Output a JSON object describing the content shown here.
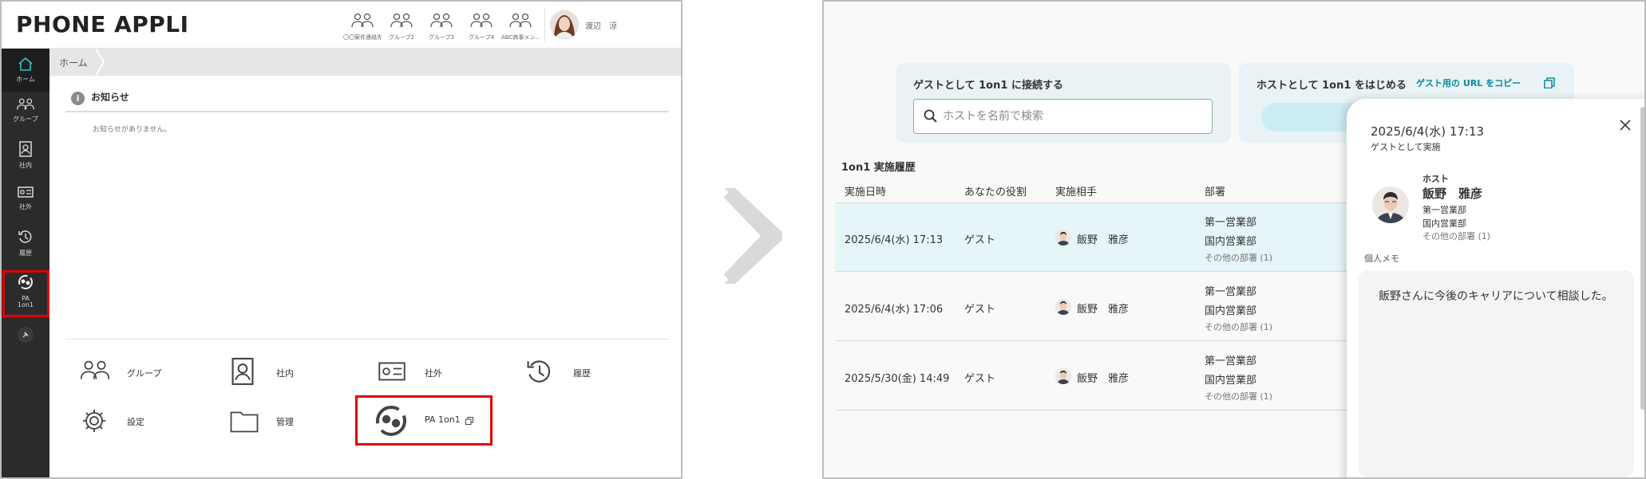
{
  "left": {
    "logo": "PHONE APPLI",
    "header_groups": [
      {
        "label": "〇〇案件連絡先"
      },
      {
        "label": "グループ2"
      },
      {
        "label": "グループ3"
      },
      {
        "label": "グループ4"
      },
      {
        "label": "ABC商事メン…"
      }
    ],
    "user_name": "渡辺　涼",
    "sidebar": [
      {
        "label": "ホーム",
        "icon": "home-icon"
      },
      {
        "label": "グループ",
        "icon": "group-icon"
      },
      {
        "label": "社内",
        "icon": "internal-directory-icon"
      },
      {
        "label": "社外",
        "icon": "external-card-icon"
      },
      {
        "label": "履歴",
        "icon": "history-icon"
      },
      {
        "label": "PA",
        "label2": "1on1",
        "icon": "pa-1on1-icon"
      },
      {
        "label": "",
        "icon": "pin-icon"
      }
    ],
    "breadcrumb": "ホーム",
    "notice": {
      "title": "お知らせ",
      "empty": "お知らせがありません。"
    },
    "tiles": [
      {
        "label": "グループ",
        "icon": "group-icon"
      },
      {
        "label": "社内",
        "icon": "internal-directory-icon"
      },
      {
        "label": "社外",
        "icon": "external-card-icon"
      },
      {
        "label": "履歴",
        "icon": "history-icon"
      },
      {
        "label": "設定",
        "icon": "gear-icon"
      },
      {
        "label": "管理",
        "icon": "folder-icon"
      },
      {
        "label": "PA 1on1",
        "icon": "pa-1on1-icon"
      }
    ],
    "highlight_color": "#e10000"
  },
  "right": {
    "guest_card_title": "ゲストとして 1on1 に接続する",
    "search_placeholder": "ホストを名前で検索",
    "host_card_title": "ホストとして 1on1 をはじめる",
    "copy_link": "ゲスト用の URL をコピー",
    "history_title": "1on1 実施履歴",
    "columns": [
      "実施日時",
      "あなたの役割",
      "実施相手",
      "部署"
    ],
    "rows": [
      {
        "date": "2025/6/4(水) 17:13",
        "role": "ゲスト",
        "partner": "飯野　雅彦",
        "dept1": "第一営業部",
        "dept2": "国内営業部",
        "dept_more": "その他の部署 (1)",
        "selected": true
      },
      {
        "date": "2025/6/4(水) 17:06",
        "role": "ゲスト",
        "partner": "飯野　雅彦",
        "dept1": "第一営業部",
        "dept2": "国内営業部",
        "dept_more": "その他の部署 (1)",
        "selected": false
      },
      {
        "date": "2025/5/30(金) 14:49",
        "role": "ゲスト",
        "partner": "飯野　雅彦",
        "dept1": "第一営業部",
        "dept2": "国内営業部",
        "dept_more": "その他の部署 (1)",
        "selected": false
      }
    ],
    "panel": {
      "date": "2025/6/4(水) 17:13",
      "role": "ゲストとして実施",
      "host_label": "ホスト",
      "host_name": "飯野　雅彦",
      "dept1": "第一営業部",
      "dept2": "国内営業部",
      "dept_more": "その他の部署 (1)",
      "memo_label": "個人メモ",
      "memo_text": "飯野さんに今後のキャリアについて相談した。"
    },
    "accent_color": "#0a8a9c",
    "selected_row_color": "#e6f5f8"
  }
}
